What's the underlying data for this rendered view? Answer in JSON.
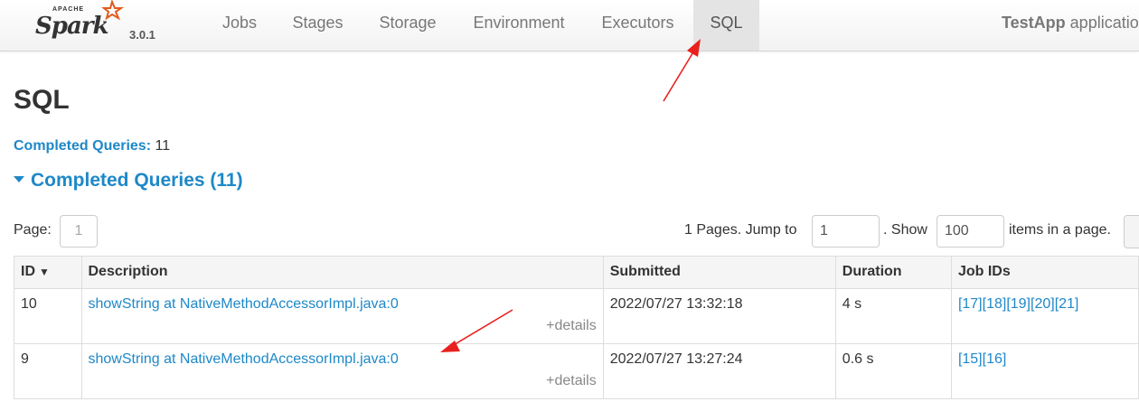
{
  "brand": {
    "apache": "APACHE",
    "name": "Spark",
    "version": "3.0.1"
  },
  "nav": {
    "tabs": [
      {
        "label": "Jobs"
      },
      {
        "label": "Stages"
      },
      {
        "label": "Storage"
      },
      {
        "label": "Environment"
      },
      {
        "label": "Executors"
      },
      {
        "label": "SQL",
        "active": true
      }
    ],
    "app_name": "TestApp",
    "app_suffix": " applicatio"
  },
  "page": {
    "title": "SQL",
    "summary_label": "Completed Queries:",
    "summary_value": "11",
    "section_header": "Completed Queries (11)"
  },
  "pagination": {
    "page_label": "Page:",
    "current_page": "1",
    "pages_text": "1 Pages. Jump to",
    "jump_value": "1",
    "show_text": ". Show",
    "show_value": "100",
    "items_text": "items in a page."
  },
  "table": {
    "columns": [
      "ID",
      "Description",
      "Submitted",
      "Duration",
      "Job IDs"
    ],
    "sort_indicator": "▼",
    "rows": [
      {
        "id": "10",
        "description": "showString at NativeMethodAccessorImpl.java:0",
        "details": "+details",
        "submitted": "2022/07/27 13:32:18",
        "duration": "4 s",
        "job_ids": [
          "[17]",
          "[18]",
          "[19]",
          "[20]",
          "[21]"
        ]
      },
      {
        "id": "9",
        "description": "showString at NativeMethodAccessorImpl.java:0",
        "details": "+details",
        "submitted": "2022/07/27 13:27:24",
        "duration": "0.6 s",
        "job_ids": [
          "[15]",
          "[16]"
        ]
      }
    ]
  },
  "colors": {
    "link": "#1e88c7",
    "annotation_arrow": "#e8201e"
  }
}
